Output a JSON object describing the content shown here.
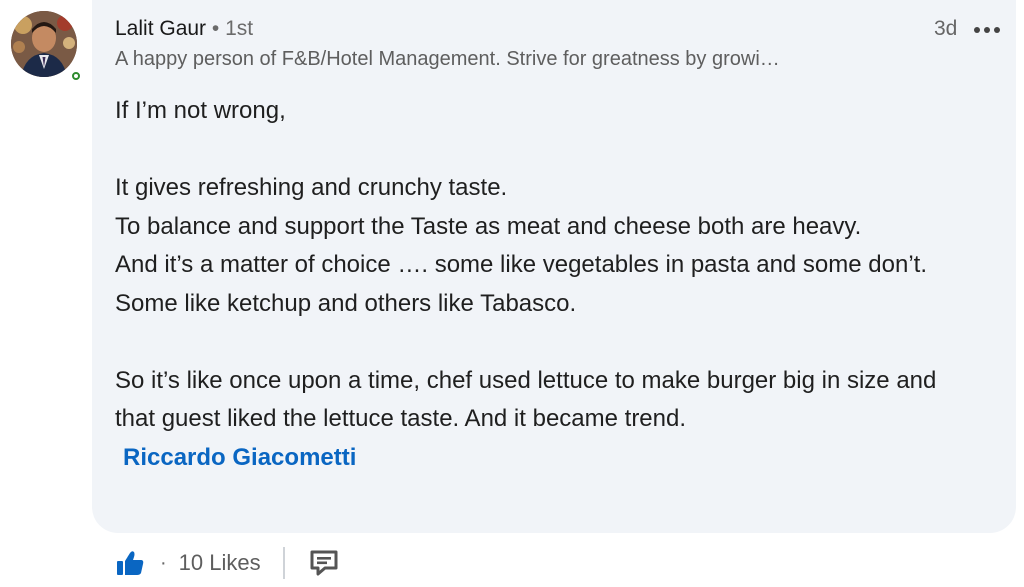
{
  "comment": {
    "author": {
      "name": "Lalit Gaur",
      "separator": " • ",
      "degree": "1st",
      "headline": "A happy person of F&B/Hotel Management. Strive for greatness by growi…"
    },
    "time": "3d",
    "body": {
      "line1": "If I’m not wrong,",
      "line2": "It gives refreshing and crunchy taste.",
      "line3": "To balance and support the Taste as meat and cheese both are heavy.",
      "line4": "And it’s a matter of choice …. some like vegetables in pasta and some don’t.",
      "line5": "Some like ketchup and others like Tabasco.",
      "line6": "So it’s like once upon a time,  chef used lettuce to make burger big in size and that guest liked the lettuce taste. And it became trend.",
      "mention": "Riccardo Giacometti"
    }
  },
  "actions": {
    "separator": "·",
    "likes_label": "10 Likes"
  },
  "icons": {
    "more": "more-options-icon",
    "like": "thumbs-up-icon",
    "reply": "comment-icon",
    "presence": "online-status-icon"
  },
  "colors": {
    "bubble": "#f1f4f8",
    "mention": "#0a66c2",
    "like_icon": "#0a66c2",
    "online": "#2e8b2e"
  }
}
